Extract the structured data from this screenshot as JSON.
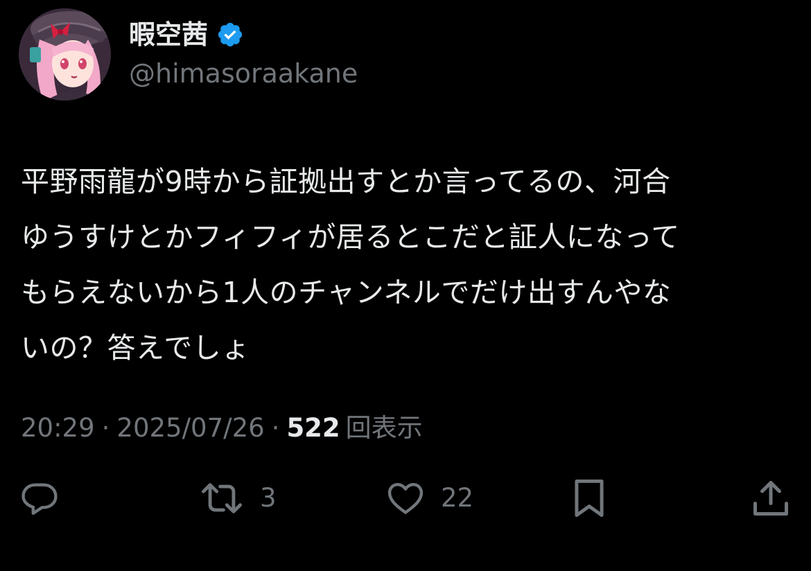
{
  "author": {
    "display_name": "暇空茜",
    "handle": "@himasoraakane",
    "verified_icon": "verified-badge-icon",
    "verified_color": "#1d9bf0"
  },
  "tweet": {
    "text": "平野雨龍が9時から証拠出すとか言ってるの、河合\nゆうすけとかフィフィが居るとこだと証人になって\nもらえないから1人のチャンネルでだけ出すんやな\nいの？答えでしょ"
  },
  "meta": {
    "time": "20:29",
    "separator": "·",
    "date": "2025/07/26",
    "views_count": "522",
    "views_label": "回表示"
  },
  "actions": {
    "reply": {
      "icon": "reply-icon",
      "count": ""
    },
    "retweet": {
      "icon": "retweet-icon",
      "count": "3"
    },
    "like": {
      "icon": "heart-icon",
      "count": "22"
    },
    "bookmark": {
      "icon": "bookmark-icon",
      "count": ""
    },
    "share": {
      "icon": "share-icon",
      "count": ""
    }
  },
  "colors": {
    "background": "#000000",
    "primary_text": "#e7e9ea",
    "secondary_text": "#71767b",
    "accent": "#1d9bf0"
  }
}
